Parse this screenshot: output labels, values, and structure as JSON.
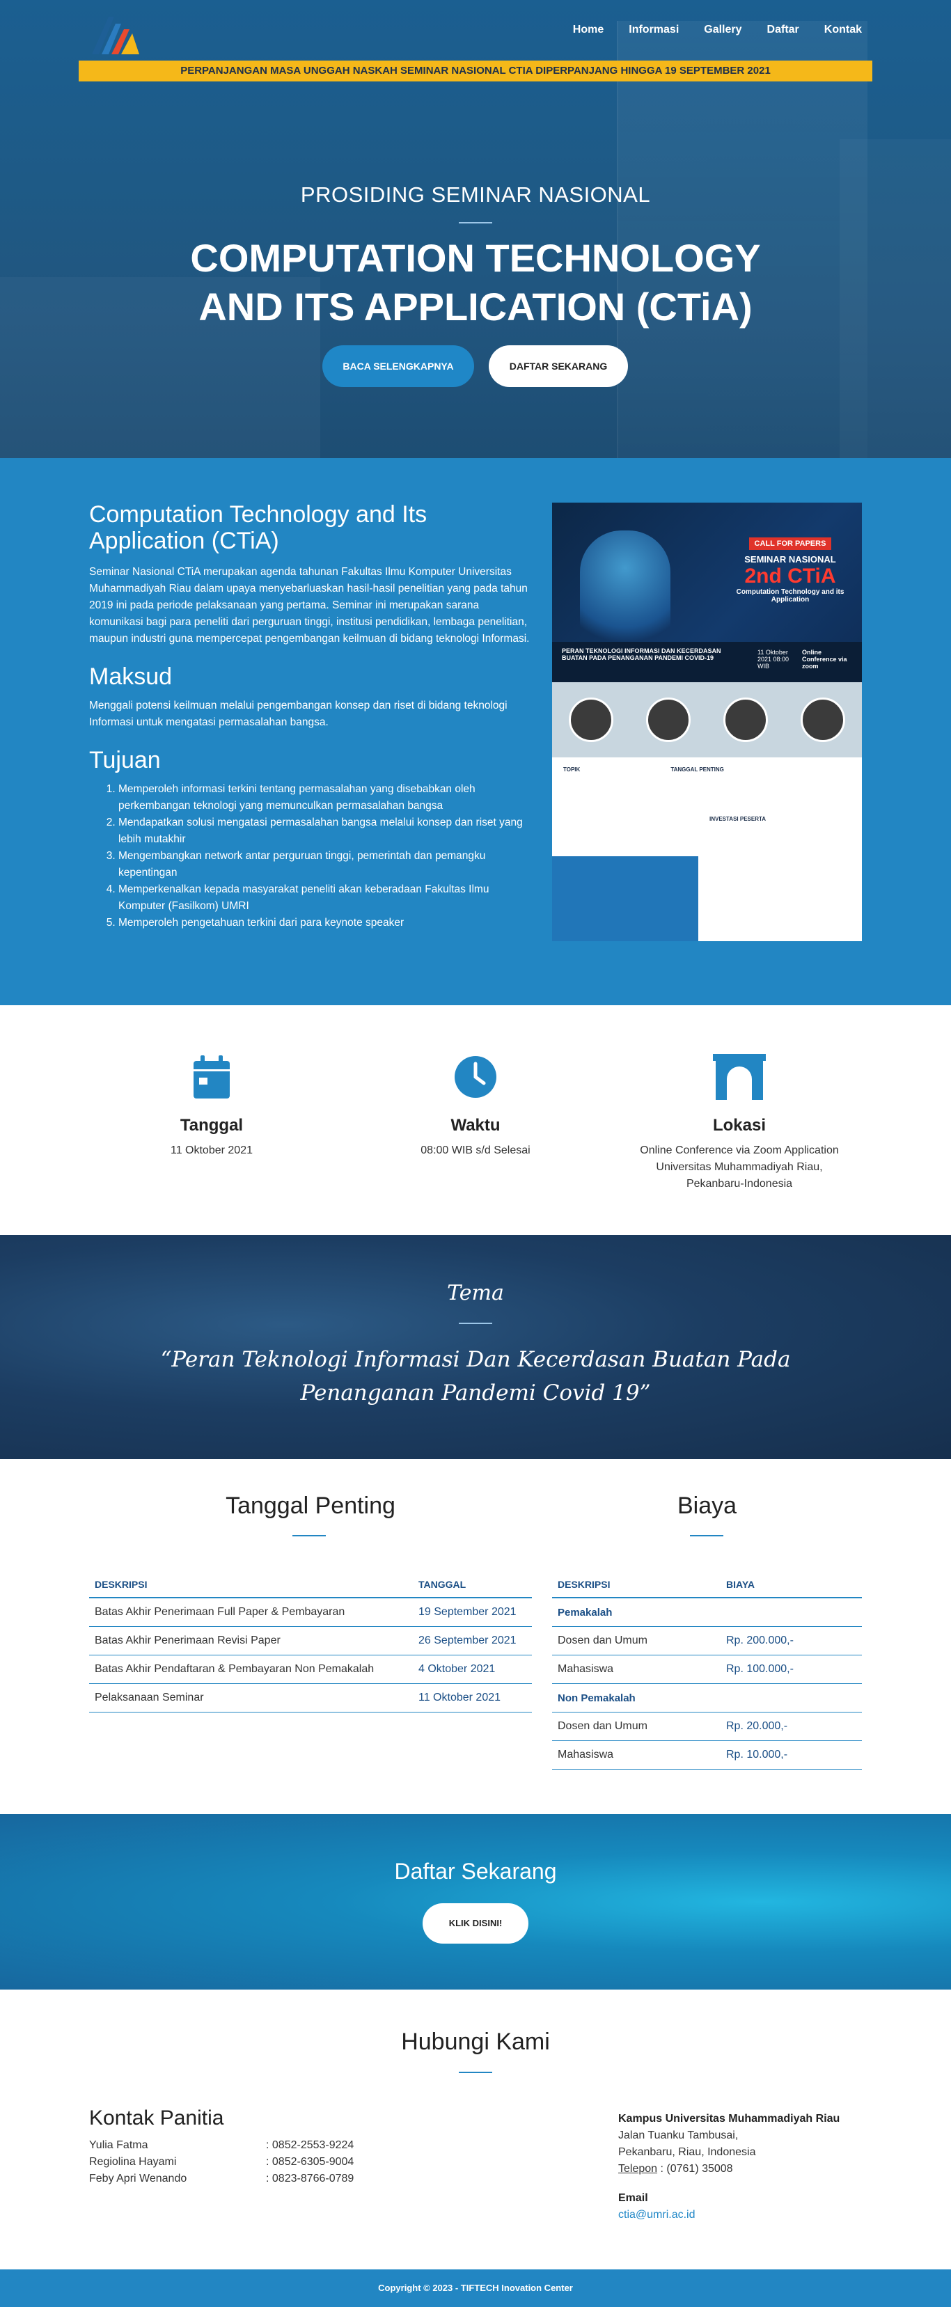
{
  "nav": {
    "items": [
      "Home",
      "Informasi",
      "Gallery",
      "Daftar",
      "Kontak"
    ]
  },
  "announcement": "PERPANJANGAN MASA UNGGAH NASKAH SEMINAR NASIONAL CTIA DIPERPANJANG HINGGA 19 SEPTEMBER 2021",
  "hero": {
    "subtitle": "PROSIDING SEMINAR NASIONAL",
    "title_line1": "COMPUTATION TECHNOLOGY",
    "title_line2": "AND ITS APPLICATION (CTiA)",
    "btn_read_more": "BACA SELENGKAPNYA",
    "btn_register": "DAFTAR SEKARANG"
  },
  "about": {
    "title": "Computation Technology and Its Application (CTiA)",
    "description": "Seminar Nasional CTiA merupakan agenda tahunan Fakultas Ilmu Komputer Universitas Muhammadiyah Riau dalam upaya menyebarluaskan hasil-hasil penelitian yang pada tahun 2019 ini pada periode pelaksanaan yang pertama. Seminar ini merupakan sarana komunikasi bagi para peneliti dari perguruan tinggi, institusi pendidikan, lembaga penelitian, maupun industri guna mempercepat pengembangan keilmuan di bidang teknologi Informasi.",
    "maksud_title": "Maksud",
    "maksud_text": "Menggali potensi keilmuan melalui pengembangan konsep dan riset di bidang teknologi Informasi untuk mengatasi permasalahan bangsa.",
    "tujuan_title": "Tujuan",
    "tujuan_items": [
      "Memperoleh informasi terkini tentang permasalahan yang disebabkan oleh perkembangan teknologi yang memunculkan permasalahan bangsa",
      "Mendapatkan solusi mengatasi permasalahan bangsa melalui konsep dan riset yang lebih mutakhir",
      "Mengembangkan network antar perguruan tinggi, pemerintah dan pemangku kepentingan",
      "Memperkenalkan kepada masyarakat peneliti akan keberadaan Fakultas Ilmu Komputer (Fasilkom) UMRI",
      "Memperoleh pengetahuan terkini dari para keynote speaker"
    ]
  },
  "poster": {
    "cfp": "CALL FOR PAPERS",
    "seminar": "SEMINAR NASIONAL",
    "edition": "2nd CTiA",
    "subtitle": "Computation Technology and its Application",
    "theme": "PERAN TEKNOLOGI INFORMASI DAN KECERDASAN BUATAN PADA PENANGANAN PANDEMI COVID-19",
    "date": "11 Oktober 2021 08:00 WIB",
    "mode": "Online Conference via zoom",
    "topik": "TOPIK",
    "tanggal_penting": "TANGGAL PENTING",
    "investasi": "INVESTASI PESERTA"
  },
  "info": {
    "date_label": "Tanggal",
    "date_value": "11 Oktober 2021",
    "time_label": "Waktu",
    "time_value": "08:00 WIB s/d Selesai",
    "loc_label": "Lokasi",
    "loc_line1": "Online Conference via Zoom Application",
    "loc_line2": "Universitas Muhammadiyah Riau,",
    "loc_line3": "Pekanbaru-Indonesia"
  },
  "tema": {
    "label": "Tema",
    "quote_line1": "“Peran Teknologi Informasi Dan Kecerdasan Buatan Pada",
    "quote_line2": "Penanganan Pandemi Covid 19”"
  },
  "dates": {
    "title": "Tanggal Penting",
    "col_desc": "DESKRIPSI",
    "col_date": "TANGGAL",
    "rows": [
      {
        "desc": "Batas Akhir Penerimaan Full Paper & Pembayaran",
        "date": "19 September 2021"
      },
      {
        "desc": "Batas Akhir Penerimaan Revisi Paper",
        "date": "26 September 2021"
      },
      {
        "desc": "Batas Akhir Pendaftaran & Pembayaran Non Pemakalah",
        "date": "4 Oktober 2021"
      },
      {
        "desc": "Pelaksanaan Seminar",
        "date": "11 Oktober 2021"
      }
    ]
  },
  "fees": {
    "title": "Biaya",
    "col_desc": "DESKRIPSI",
    "col_fee": "BIAYA",
    "group1": "Pemakalah",
    "group1_rows": [
      {
        "desc": "Dosen dan Umum",
        "fee": "Rp. 200.000,-"
      },
      {
        "desc": "Mahasiswa",
        "fee": "Rp. 100.000,-"
      }
    ],
    "group2": "Non Pemakalah",
    "group2_rows": [
      {
        "desc": "Dosen dan Umum",
        "fee": "Rp. 20.000,-"
      },
      {
        "desc": "Mahasiswa",
        "fee": "Rp. 10.000,-"
      }
    ]
  },
  "register": {
    "title": "Daftar Sekarang",
    "button": "KLIK DISINI!"
  },
  "contact": {
    "title": "Hubungi Kami",
    "panitia_title": "Kontak Panitia",
    "people": [
      {
        "name": "Yulia Fatma",
        "phone": ": 0852-2553-9224"
      },
      {
        "name": "Regiolina Hayami",
        "phone": ": 0852-6305-9004"
      },
      {
        "name": "Feby Apri Wenando",
        "phone": ": 0823-8766-0789"
      }
    ],
    "campus": "Kampus Universitas Muhammadiyah Riau",
    "street": "Jalan Tuanku Tambusai,",
    "city": "Pekanbaru, Riau, Indonesia",
    "phone_label": "Telepon",
    "phone": ": (0761) 35008",
    "email_label": "Email",
    "email": "ctia@umri.ac.id"
  },
  "footer": "Copyright © 2023 - TIFTECH Inovation Center"
}
